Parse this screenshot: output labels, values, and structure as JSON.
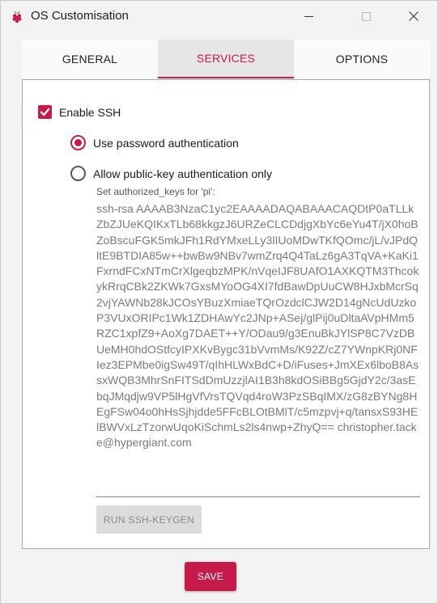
{
  "window": {
    "title": "OS Customisation",
    "accent_color": "#c51a4a"
  },
  "tabs": [
    {
      "label": "GENERAL",
      "selected": false
    },
    {
      "label": "SERVICES",
      "selected": true
    },
    {
      "label": "OPTIONS",
      "selected": false
    }
  ],
  "services": {
    "enable_ssh_label": "Enable SSH",
    "enable_ssh_checked": true,
    "auth_password_label": "Use password authentication",
    "auth_password_selected": true,
    "auth_pubkey_label": "Allow public-key authentication only",
    "auth_pubkey_selected": false,
    "authorized_keys_label": "Set authorized_keys for 'pi':",
    "authorized_keys_value": "ssh-rsa AAAAB3NzaC1yc2EAAAADAQABAAACAQDtP0aTLLkZbZJUeKQIKxTLb68kkgzJ6URZeCLCDdjgXbYc6eYu4T/jX0hoBZoBscuFGK5mkJFh1RdYMxeLLy3lIUoMDwTKfQOmc/jL/vJPdQltE9BTDIA85w++bwBw9NBv7wmZrq4Q4TaLz6gA3TqVA+KaKi1FxrndFCxNTmCrXlgeqbzMPK/nVqeIJF8UAfO1AXKQTM3ThcokykRrqCBk2ZKWk7GxsMYoOG4XI7fdBawDpUuCW8HJxbMcrSq2vjYAWNb28kJCOsYBuzXmiaeTQrOzdclCJW2D14gNcUdUzkoP3VUxORIPc1Wk1ZDHAwYc2JNp+ASej/glPij0uDltaAVpHMm5RZC1xpfZ9+AoXg7DAET++Y/ODau9/g3EnuBkJYlSP8C7VzDBUeMH0hdOStfcyIPXKvBygc31bVvmMs/K92Z/cZ7YWnpKRj0NFIez3EPMbe0igSw49T/qIhHLWxBdC+D/iFuses+JmXEx6lboB8AssxWQB3MhrSnFITSdDmUzzjlAI1B3h8kdOSiBBg5GjdY2c/3asEbqJMqdjw9VP5lHgVfVrsTQVqd4roW3PzSBqIMX/zG8zBYNg8HEgFSw04o0hHsSjhjdde5FFcBLOtBMlT/c5mzpvj+q/tansxS93HElBWVxLzTzorwUqoKiSchmLs2ls4nwp+ZhyQ== christopher.tacke@hypergiant.com",
    "keygen_label": "RUN SSH-KEYGEN"
  },
  "footer": {
    "save_label": "SAVE"
  },
  "icons": {
    "app": "raspberry-pi-icon",
    "minimize": "minimize-icon",
    "maximize": "maximize-icon",
    "close": "close-icon"
  }
}
